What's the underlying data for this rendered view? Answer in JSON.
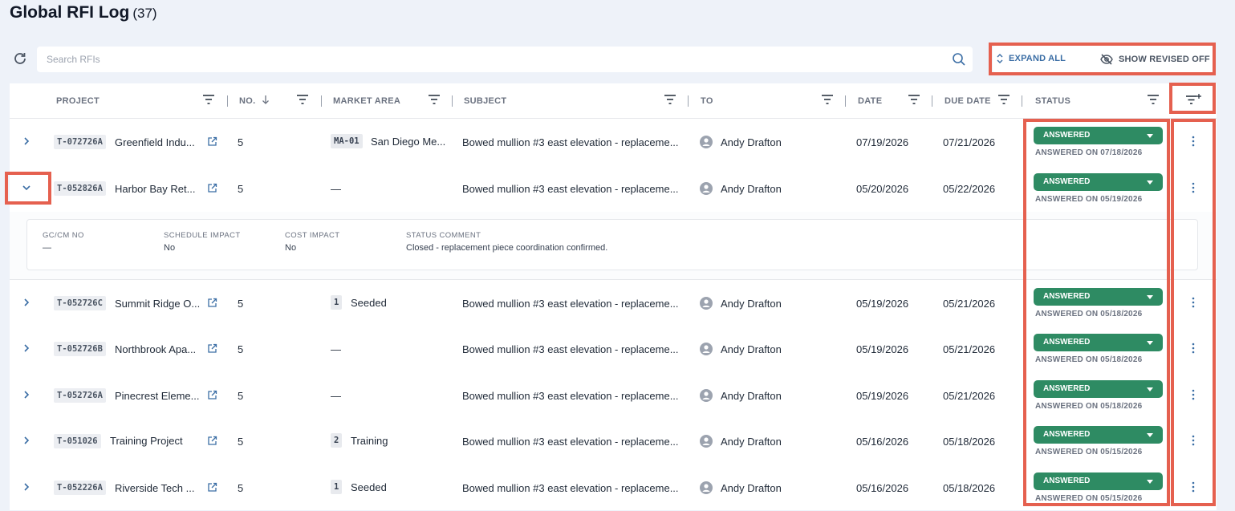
{
  "page": {
    "title": "Global RFI Log",
    "count": "(37)"
  },
  "toolbar": {
    "search_placeholder": "Search RFIs",
    "expand_all": "EXPAND ALL",
    "show_revised": "SHOW REVISED OFF"
  },
  "icons": {
    "refresh": "refresh-icon",
    "search": "search-icon",
    "filter": "filter-icon",
    "add_filter": "filter-plus-icon",
    "eye_off": "eye-off-icon"
  },
  "colors": {
    "accent": "#3b6ea5",
    "status_green": "#2e8b63",
    "highlight": "#e5604f"
  },
  "columns": {
    "project": "PROJECT",
    "no": "NO.",
    "market_area": "MARKET AREA",
    "subject": "SUBJECT",
    "to": "TO",
    "date": "DATE",
    "due_date": "DUE DATE",
    "status": "STATUS"
  },
  "rows": [
    {
      "code": "T-072726A",
      "project": "Greenfield Indu...",
      "no": "5",
      "ma_badge": "MA-01",
      "ma_text": "San Diego Me...",
      "subject": "Bowed mullion #3 east elevation - replaceme...",
      "to": "Andy Drafton",
      "date": "07/19/2026",
      "due": "07/21/2026",
      "status": "ANSWERED",
      "status_sub": "ANSWERED ON 07/18/2026"
    },
    {
      "code": "T-052826A",
      "project": "Harbor Bay Ret...",
      "no": "5",
      "ma_badge": "",
      "ma_text": "—",
      "subject": "Bowed mullion #3 east elevation - replaceme...",
      "to": "Andy Drafton",
      "date": "05/20/2026",
      "due": "05/22/2026",
      "status": "ANSWERED",
      "status_sub": "ANSWERED ON 05/19/2026"
    },
    {
      "code": "T-052726C",
      "project": "Summit Ridge O...",
      "no": "5",
      "ma_badge": "1",
      "ma_text": "Seeded",
      "subject": "Bowed mullion #3 east elevation - replaceme...",
      "to": "Andy Drafton",
      "date": "05/19/2026",
      "due": "05/21/2026",
      "status": "ANSWERED",
      "status_sub": "ANSWERED ON 05/18/2026"
    },
    {
      "code": "T-052726B",
      "project": "Northbrook Apa...",
      "no": "5",
      "ma_badge": "",
      "ma_text": "—",
      "subject": "Bowed mullion #3 east elevation - replaceme...",
      "to": "Andy Drafton",
      "date": "05/19/2026",
      "due": "05/21/2026",
      "status": "ANSWERED",
      "status_sub": "ANSWERED ON 05/18/2026"
    },
    {
      "code": "T-052726A",
      "project": "Pinecrest Eleme...",
      "no": "5",
      "ma_badge": "",
      "ma_text": "—",
      "subject": "Bowed mullion #3 east elevation - replaceme...",
      "to": "Andy Drafton",
      "date": "05/19/2026",
      "due": "05/21/2026",
      "status": "ANSWERED",
      "status_sub": "ANSWERED ON 05/18/2026"
    },
    {
      "code": "T-051026",
      "project": "Training Project",
      "no": "5",
      "ma_badge": "2",
      "ma_text": "Training",
      "subject": "Bowed mullion #3 east elevation - replaceme...",
      "to": "Andy Drafton",
      "date": "05/16/2026",
      "due": "05/18/2026",
      "status": "ANSWERED",
      "status_sub": "ANSWERED ON 05/15/2026"
    },
    {
      "code": "T-052226A",
      "project": "Riverside Tech ...",
      "no": "5",
      "ma_badge": "1",
      "ma_text": "Seeded",
      "subject": "Bowed mullion #3 east elevation - replaceme...",
      "to": "Andy Drafton",
      "date": "05/16/2026",
      "due": "05/18/2026",
      "status": "ANSWERED",
      "status_sub": "ANSWERED ON 05/15/2026"
    }
  ],
  "detail": {
    "gc_label": "GC/CM NO",
    "gc_value": "—",
    "schedule_label": "SCHEDULE IMPACT",
    "schedule_value": "No",
    "cost_label": "COST IMPACT",
    "cost_value": "No",
    "comment_label": "STATUS COMMENT",
    "comment_value": "Closed - replacement piece coordination confirmed."
  }
}
